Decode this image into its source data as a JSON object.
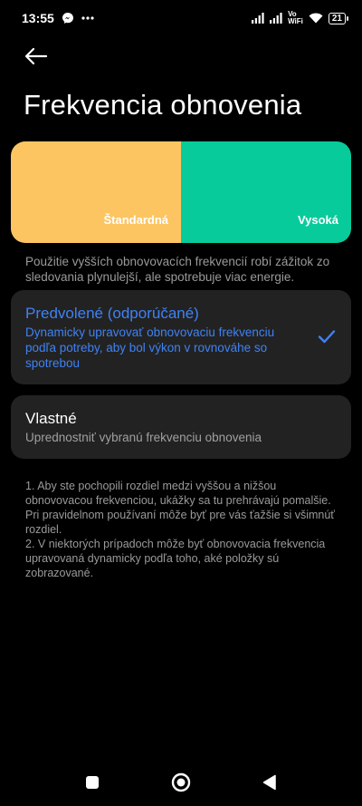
{
  "status_bar": {
    "time": "13:55",
    "notification_icons": [
      "messenger-icon",
      "more-dots-icon"
    ],
    "vowifi_line1": "Vo",
    "vowifi_line2": "WiFi",
    "battery": "21"
  },
  "header": {
    "title": "Frekvencia obnovenia"
  },
  "preview": {
    "standard_label": "Štandardná",
    "high_label": "Vysoká",
    "standard_color": "#fcc562",
    "high_color": "#08cb9b"
  },
  "description": "Použitie vyšších obnovovacích frekvencií robí zážitok zo sledovania plynulejší, ale spotrebuje viac energie.",
  "options": [
    {
      "title": "Predvolené (odporúčané)",
      "subtitle": "Dynamicky upravovať obnovovaciu frekvenciu podľa potreby, aby bol výkon v rovnováhe so spotrebou",
      "selected": true
    },
    {
      "title": "Vlastné",
      "subtitle": "Uprednostniť vybranú frekvenciu obnovenia",
      "selected": false
    }
  ],
  "notes": {
    "note1": "1. Aby ste pochopili rozdiel medzi vyššou a nižšou obnovovacou frekvenciou, ukážky sa tu prehrávajú pomalšie. Pri pravidelnom používaní môže byť pre vás ťažšie si všimnúť rozdiel.",
    "note2": "2. V niektorých prípadoch môže byť obnovovacia frekvencia upravovaná dynamicky podľa toho, aké položky sú zobrazované."
  },
  "colors": {
    "accent": "#3f82f4",
    "card_bg": "#222222",
    "background": "#000000"
  },
  "nav_bar": {
    "icons": [
      "recent-apps-icon",
      "home-icon",
      "back-nav-icon"
    ]
  }
}
